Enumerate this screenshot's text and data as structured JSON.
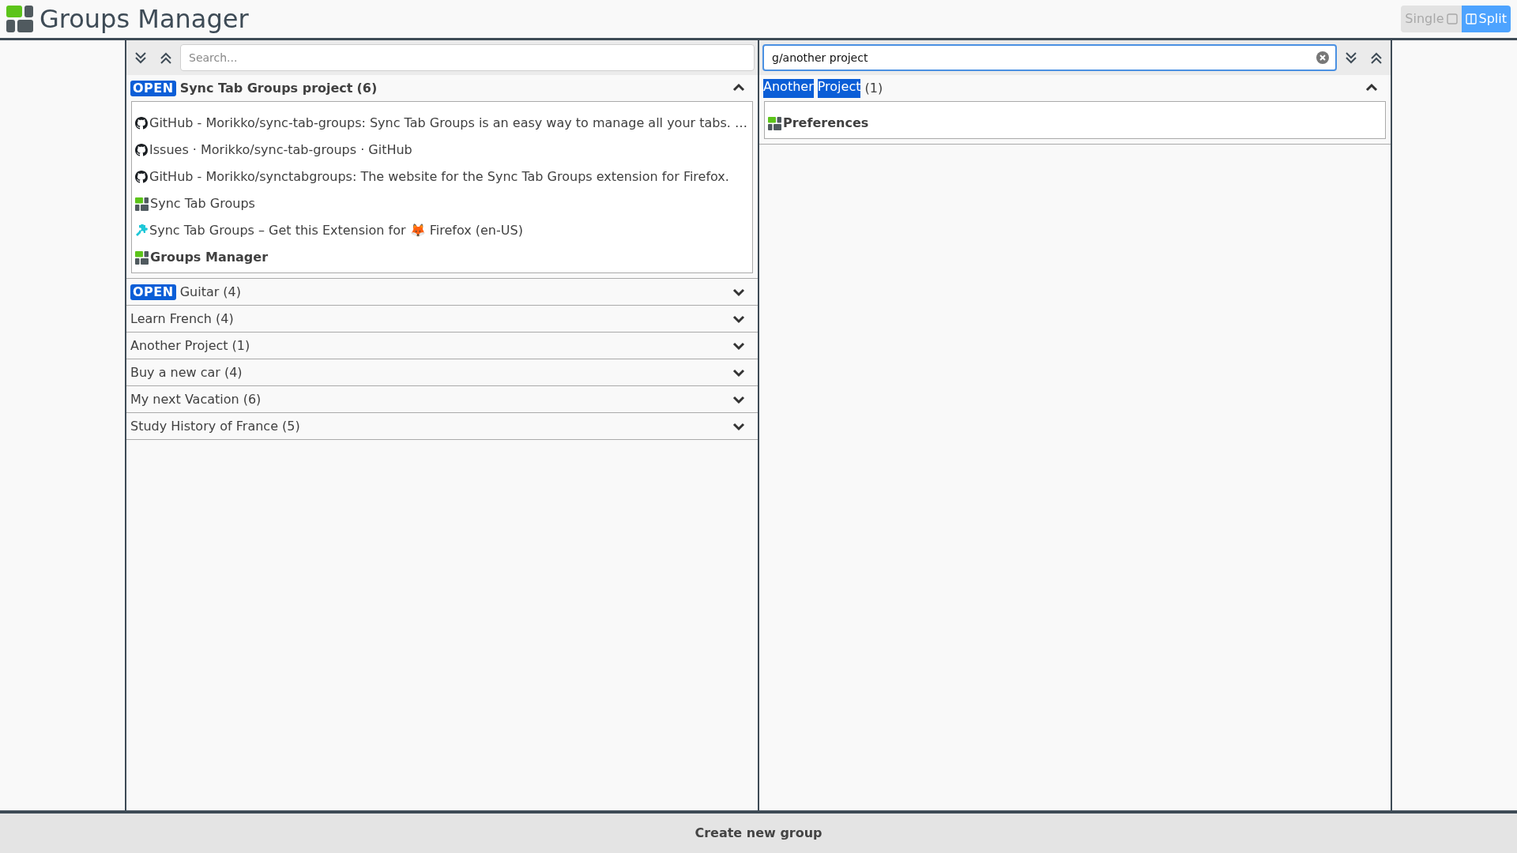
{
  "app": {
    "title": "Groups Manager"
  },
  "view_toggle": [
    {
      "label": "Single",
      "kind": "single",
      "selected": false
    },
    {
      "label": "Split",
      "kind": "split",
      "selected": true
    }
  ],
  "panels": [
    {
      "search": {
        "placeholder": "Search..."
      },
      "groups": [
        {
          "badge": "OPEN",
          "title_parts": [
            {
              "text": "Sync Tab Groups project",
              "highlighted": false
            }
          ],
          "count": "(6)",
          "current": true,
          "expanded": true,
          "tabs": [
            {
              "title": "GitHub - Morikko/sync-tab-groups: Sync Tab Groups is an easy way to manage all your tabs. …",
              "kind": "github",
              "active": false
            },
            {
              "title": "Issues · Morikko/sync-tab-groups · GitHub",
              "kind": "github",
              "active": false
            },
            {
              "title": "GitHub - Morikko/synctabgroups: The website for the Sync Tab Groups extension for Firefox.",
              "kind": "github",
              "active": false
            },
            {
              "title": "Sync Tab Groups",
              "kind": "app",
              "active": false
            },
            {
              "title": "Sync Tab Groups – Get this Extension for 🦊 Firefox (en-US)",
              "kind": "puzzle",
              "active": false
            },
            {
              "title": "Groups Manager",
              "kind": "app",
              "active": true
            }
          ]
        },
        {
          "badge": "OPEN",
          "title_parts": [
            {
              "text": "Guitar",
              "highlighted": false
            }
          ],
          "count": "(4)",
          "current": false,
          "expanded": false
        },
        {
          "title_parts": [
            {
              "text": "Learn French",
              "highlighted": false
            }
          ],
          "count": "(4)",
          "current": false,
          "expanded": false
        },
        {
          "title_parts": [
            {
              "text": "Another Project",
              "highlighted": false
            }
          ],
          "count": "(1)",
          "current": false,
          "expanded": false
        },
        {
          "title_parts": [
            {
              "text": "Buy a new car",
              "highlighted": false
            }
          ],
          "count": "(4)",
          "current": false,
          "expanded": false
        },
        {
          "title_parts": [
            {
              "text": "My next Vacation",
              "highlighted": false
            }
          ],
          "count": "(6)",
          "current": false,
          "expanded": false
        },
        {
          "title_parts": [
            {
              "text": "Study History of France",
              "highlighted": false
            }
          ],
          "count": "(5)",
          "current": false,
          "expanded": false
        }
      ]
    },
    {
      "search": {
        "value": "g/another project"
      },
      "groups": [
        {
          "title_parts": [
            {
              "text": "Another",
              "highlighted": true
            },
            {
              "text": "Project",
              "highlighted": true
            }
          ],
          "count": "(1)",
          "current": false,
          "expanded": true,
          "tabs": [
            {
              "title": "Preferences",
              "kind": "app",
              "active": true
            }
          ]
        }
      ]
    }
  ],
  "footer": {
    "button": "Create new group"
  }
}
